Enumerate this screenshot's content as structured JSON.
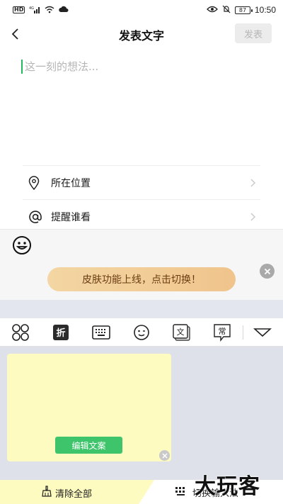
{
  "status_bar": {
    "left_icons": [
      "hd-icon",
      "signal-4g-icon",
      "wifi-icon",
      "cloud-icon"
    ],
    "hd_label": "HD",
    "network_label": "4G",
    "right_icons": [
      "eye-icon",
      "bell-off-icon",
      "battery-icon"
    ],
    "battery_level": "87",
    "time": "10:50"
  },
  "header": {
    "title": "发表文字",
    "publish_label": "发表"
  },
  "composer": {
    "placeholder": "这一刻的想法..."
  },
  "options": {
    "location_label": "所在位置",
    "mention_label": "提醒谁看"
  },
  "banner": {
    "text": "皮肤功能上线，点击切换！"
  },
  "keyboard": {
    "tool_icons": [
      "grid-icon",
      "fold-icon",
      "keyboard-icon",
      "emoji-face-icon",
      "text-icon",
      "common-phrase-icon",
      "collapse-icon"
    ],
    "fold_label": "折",
    "text_label": "文",
    "common_label": "常",
    "edit_copy_label": "编辑文案",
    "clear_all_label": "清除全部",
    "switch_input_label": "切换输入法",
    "watermark": "大玩客"
  },
  "colors": {
    "accent_green": "#3ec46b",
    "banner_bg": "#f0c48c",
    "note_bg": "#fdfbbf",
    "keyboard_bg": "#e3e5ef"
  }
}
